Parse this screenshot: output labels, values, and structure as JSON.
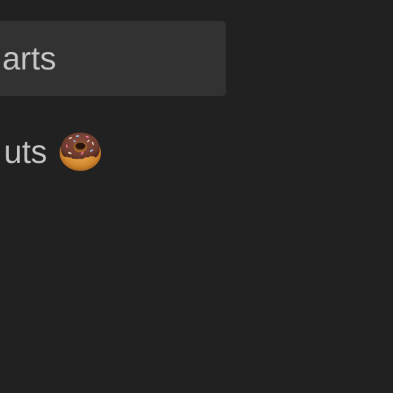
{
  "list": {
    "items": [
      {
        "label": "arts",
        "selected": true,
        "icon": ""
      },
      {
        "label": "uts",
        "selected": false,
        "icon": "donut-icon"
      }
    ]
  },
  "colors": {
    "background": "#212121",
    "selected_row": "#323232",
    "text": "#c6c6c6"
  }
}
